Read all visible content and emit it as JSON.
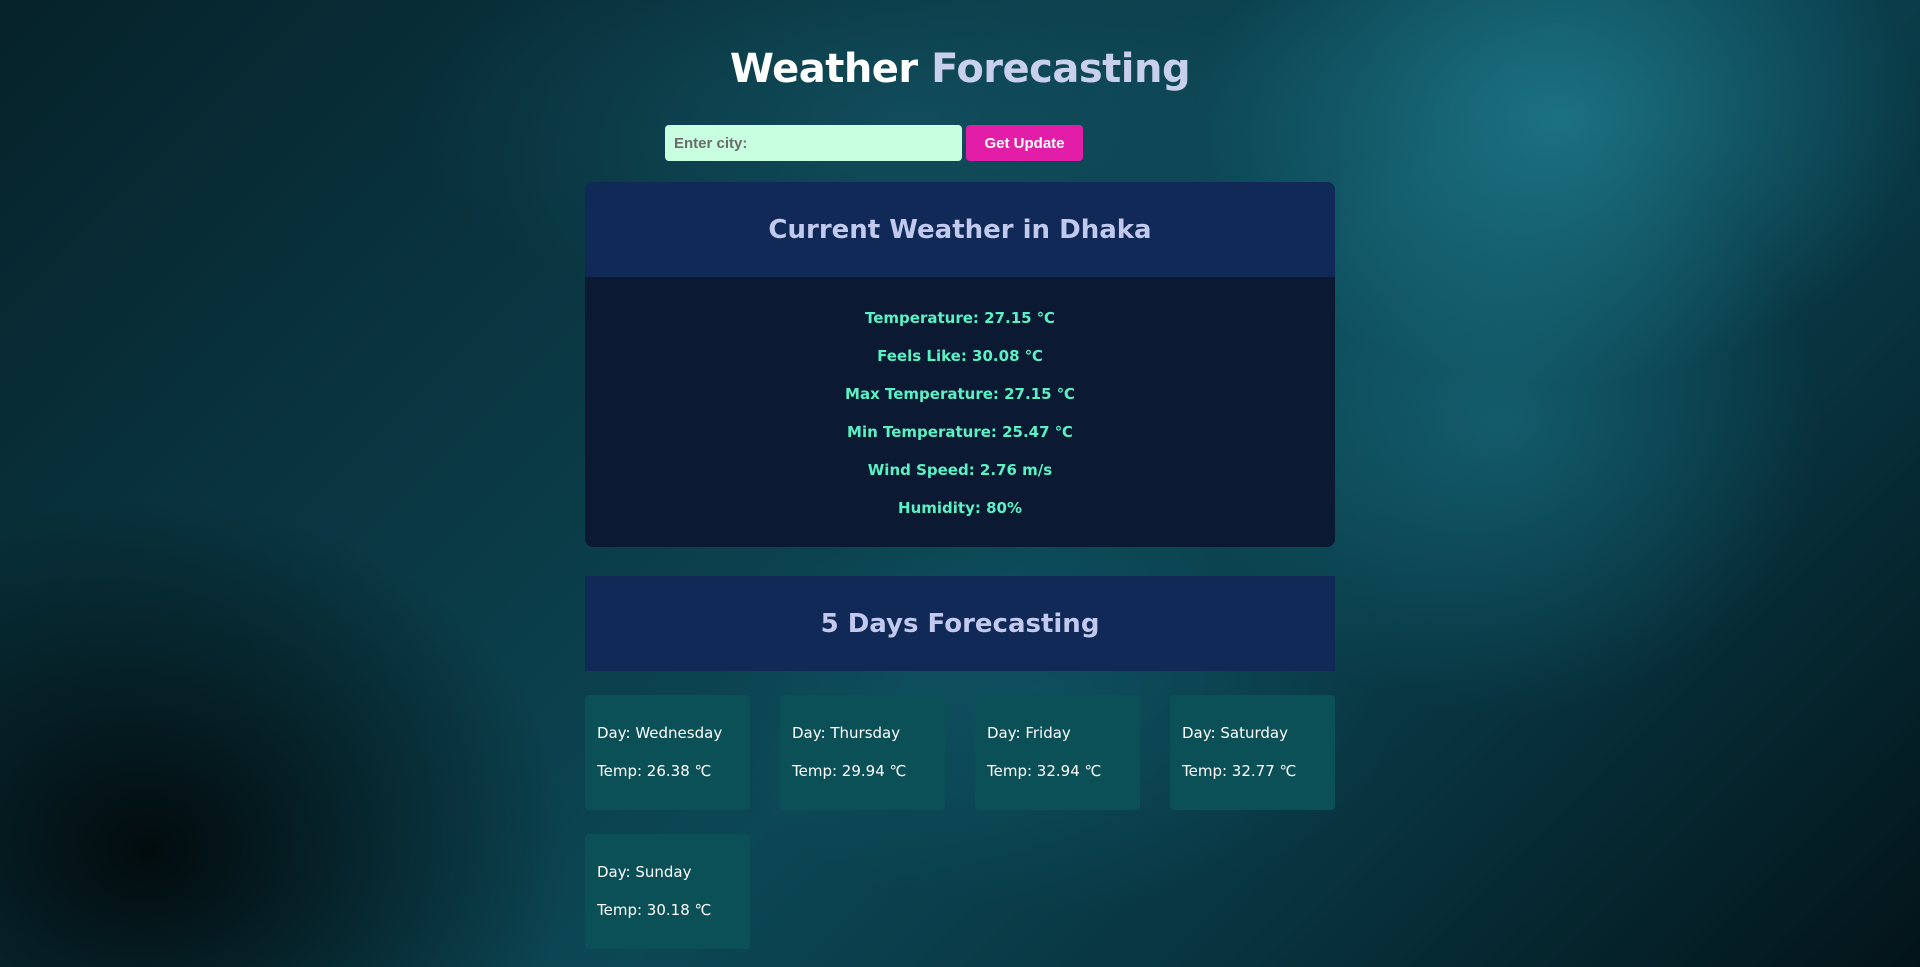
{
  "header": {
    "title_part1": "Weather",
    "title_part2": "Forecasting"
  },
  "search": {
    "placeholder": "Enter city:",
    "value": "",
    "button_label": "Get Update"
  },
  "current": {
    "heading": "Current Weather in Dhaka",
    "stats": [
      {
        "label": "Temperature: 27.15 ℃"
      },
      {
        "label": "Feels Like: 30.08 ℃"
      },
      {
        "label": "Max Temperature: 27.15 ℃"
      },
      {
        "label": "Min Temperature: 25.47 ℃"
      },
      {
        "label": "Wind Speed: 2.76 m/s"
      },
      {
        "label": "Humidity: 80%"
      }
    ]
  },
  "forecast": {
    "heading": "5 Days Forecasting",
    "days": [
      {
        "day": "Day: Wednesday",
        "temp": "Temp: 26.38 ℃"
      },
      {
        "day": "Day: Thursday",
        "temp": "Temp: 29.94 ℃"
      },
      {
        "day": "Day: Friday",
        "temp": "Temp: 32.94 ℃"
      },
      {
        "day": "Day: Saturday",
        "temp": "Temp: 32.77 ℃"
      },
      {
        "day": "Day: Sunday",
        "temp": "Temp: 30.18 ℃"
      }
    ]
  },
  "colors": {
    "accent_button": "#e21ea9",
    "input_bg": "#c8ffe0",
    "stat_text": "#5af2c5",
    "header_bg": "#112956",
    "card_bg": "#0b1932",
    "day_card_bg": "#0b4f57"
  }
}
